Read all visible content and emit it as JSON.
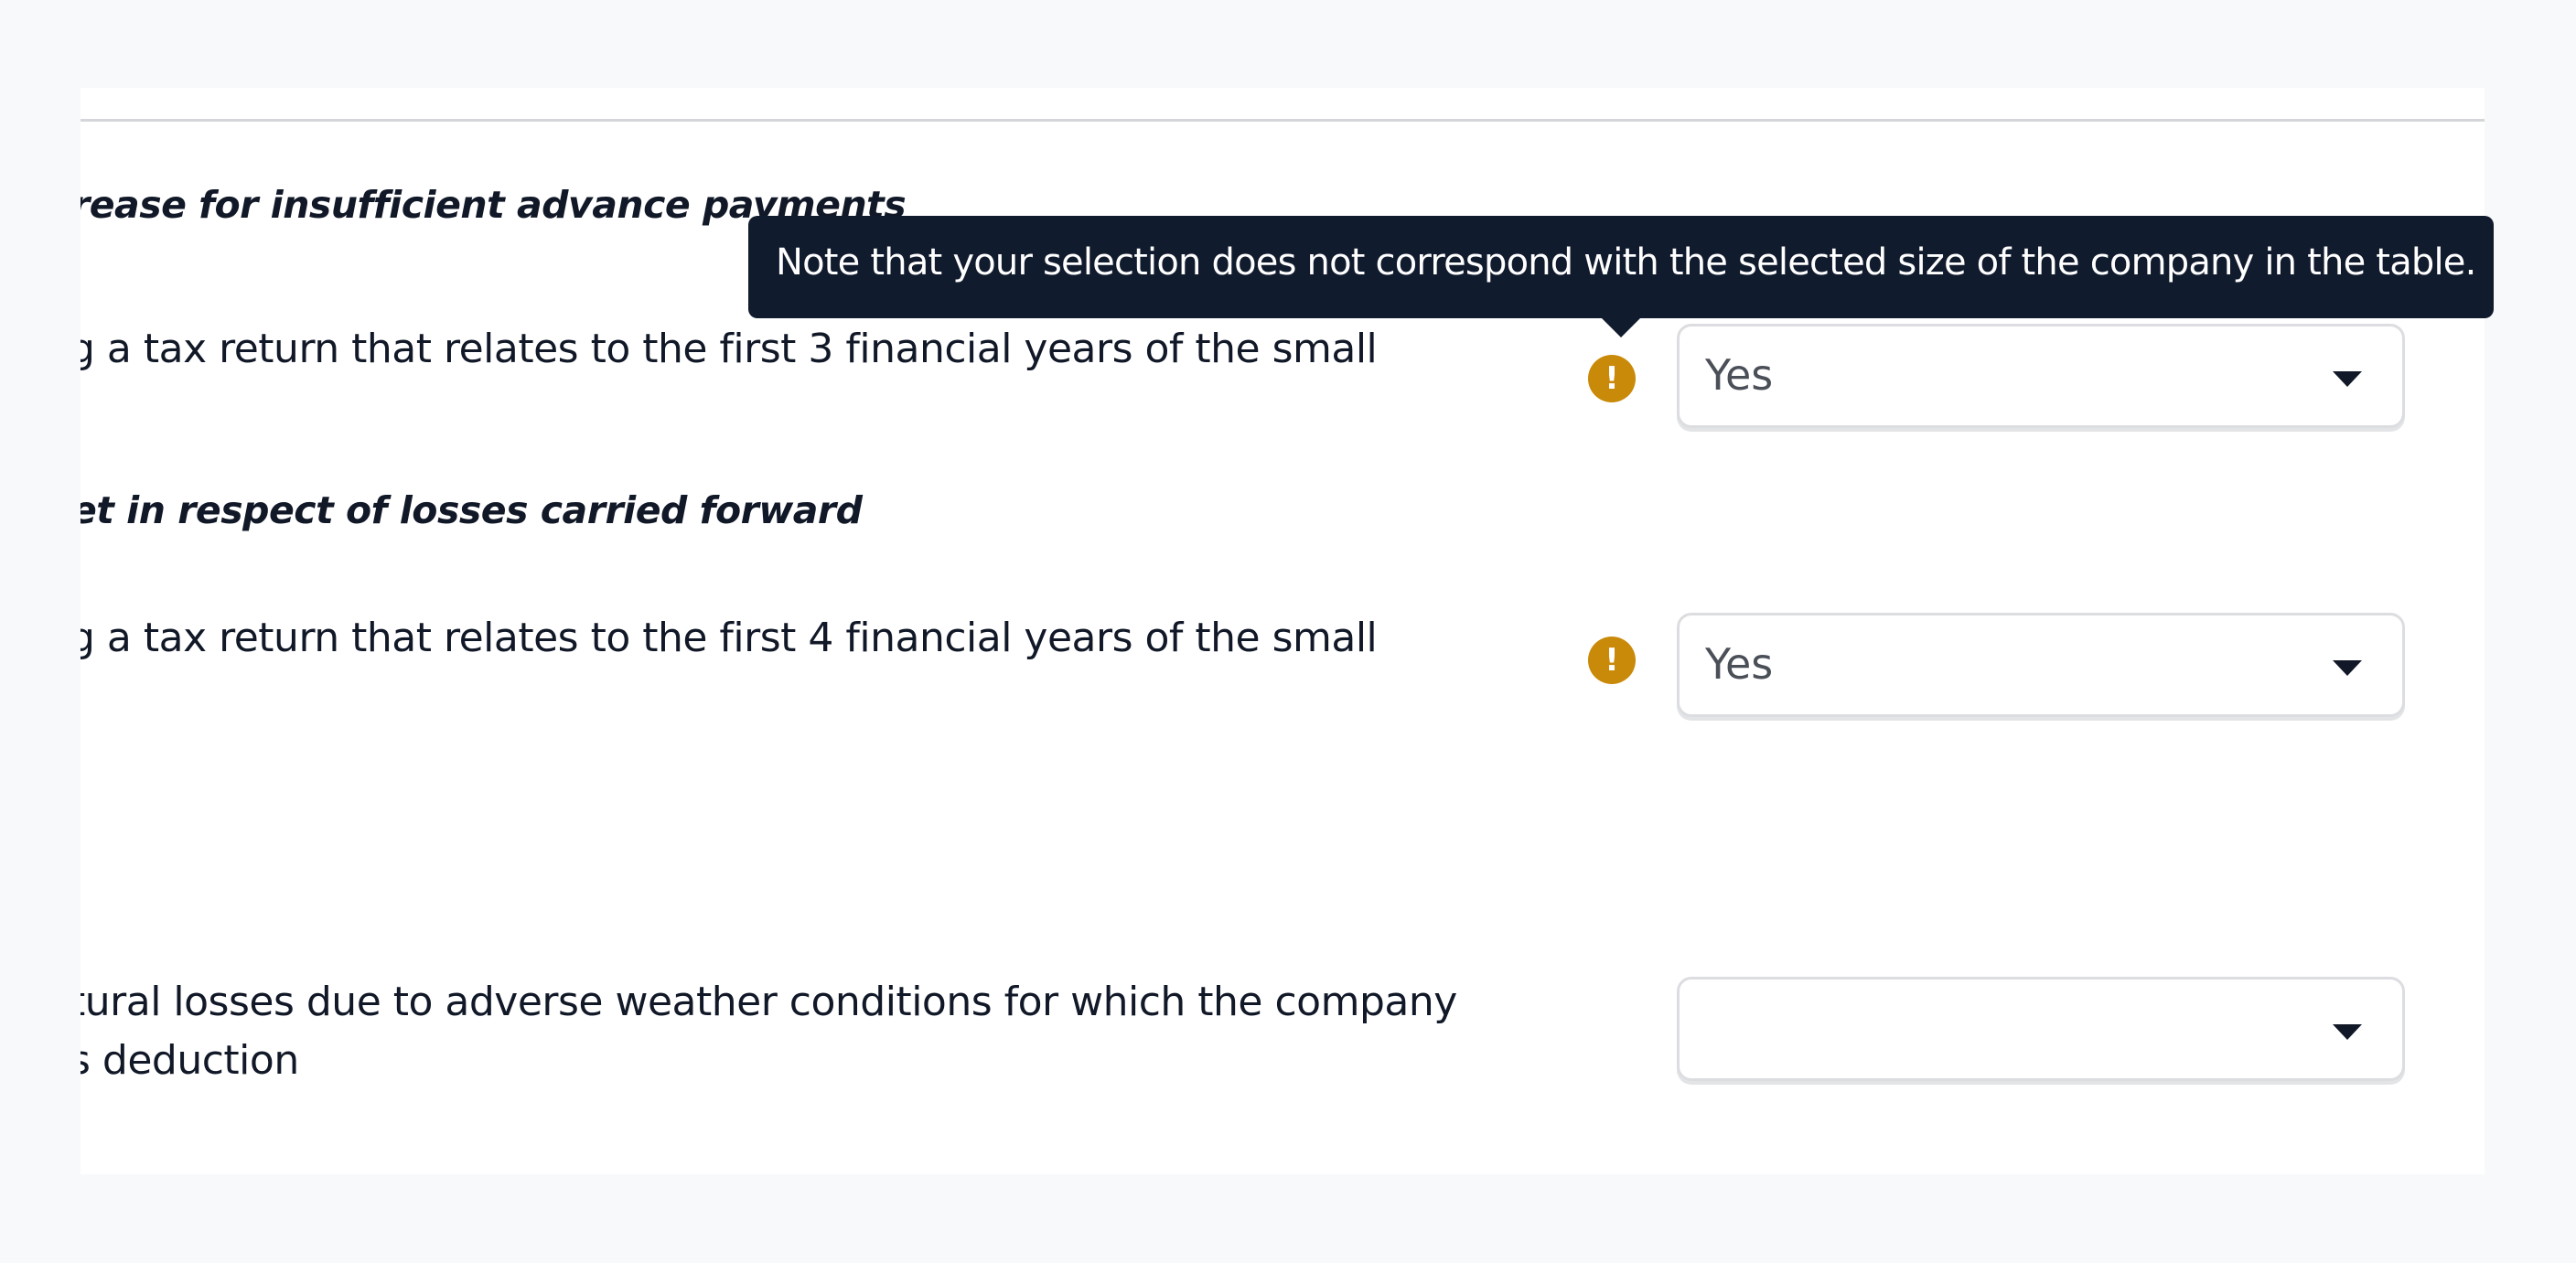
{
  "sections": [
    {
      "heading": "rease for insufficient advance payments",
      "question": {
        "line1": "g a tax return that relates to the first 3 financial years of the small",
        "line2": ""
      },
      "warning_icon": "exclamation-icon",
      "select": {
        "value": "Yes",
        "options_visible": [
          "Yes"
        ]
      }
    },
    {
      "heading": "et in respect of losses carried forward",
      "question": {
        "line1": "g a tax return that relates to the first 4 financial years of the small",
        "line2": ""
      },
      "warning_icon": "exclamation-icon",
      "select": {
        "value": "Yes",
        "options_visible": [
          "Yes"
        ]
      }
    },
    {
      "heading": "",
      "question": {
        "line1": "tural losses due to adverse weather conditions for which the company",
        "line2": "s deduction"
      },
      "select": {
        "value": ""
      }
    }
  ],
  "tooltip": {
    "text": "Note that your selection does not correspond with the selected size of the company in the table."
  },
  "colors": {
    "warning": "#c98a0a",
    "tooltip_bg": "#111b2e",
    "page_bg": "#f8f9fb"
  }
}
